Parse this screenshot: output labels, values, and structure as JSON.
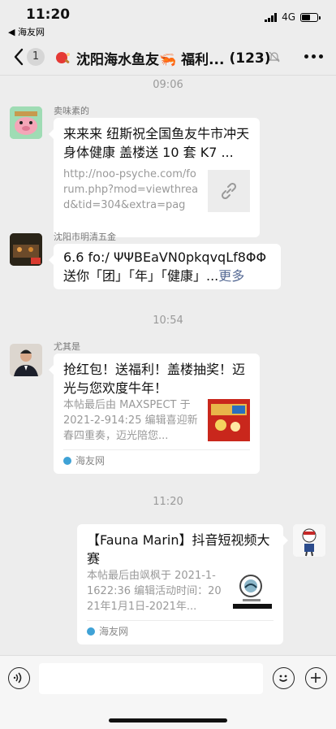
{
  "status_bar": {
    "time": "11:20",
    "back_app": "◀ 海友网",
    "network": "4G",
    "battery_level": 0.55
  },
  "nav": {
    "unread_count": "1",
    "title": "沈阳海水鱼友🦐 福利...",
    "member_count": "(123)"
  },
  "messages": {
    "time_1": "09:06",
    "time_2": "10:54",
    "time_3": "11:20",
    "m1": {
      "sender": "卖味素的",
      "title": "来来来 纽斯祝全国鱼友牛市冲天 身体健康 盖楼送 10 套 K7 ...",
      "desc": "http://noo-psyche.com/forum.php?mod=viewthread&tid=304&extra=page..."
    },
    "m2": {
      "sender": "沈阳市明清五金",
      "line1": "6.6 fo:/ ΨΨBEaVN0pkqvqLf8ΦΦ",
      "line2": "送你「团」「年」「健康」...",
      "more": "更多"
    },
    "m3": {
      "sender": "尤其是",
      "title": "抢红包！送福利！盖楼抽奖！迈光与您欢度牛年！",
      "desc": "本帖最后由 MAXSPECT 于 2021-2-914:25 编辑喜迎新春四重奏，迈光陪您...",
      "source": "海友网"
    },
    "m4": {
      "title": "【Fauna Marin】抖音短视频大赛",
      "desc": "本帖最后由飒枫于 2021-1-1622:36 编辑活动时间：2021年1月1日-2021年...",
      "source": "海友网"
    }
  },
  "colors": {
    "background": "#ededed",
    "bubble": "#ffffff",
    "link": "#576b95"
  }
}
